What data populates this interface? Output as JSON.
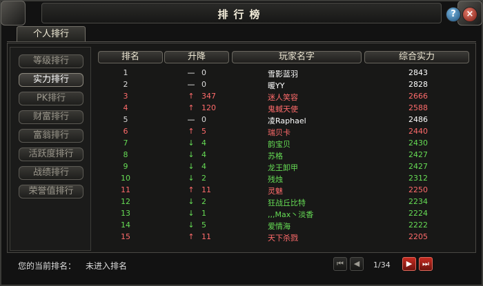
{
  "window": {
    "title": "排行榜",
    "help_label": "?",
    "close_label": "×"
  },
  "tabs": [
    {
      "label": "个人排行"
    }
  ],
  "sidebar": {
    "items": [
      {
        "label": "等级排行"
      },
      {
        "label": "实力排行",
        "active": true
      },
      {
        "label": "PK排行"
      },
      {
        "label": "财富排行"
      },
      {
        "label": "富翁排行"
      },
      {
        "label": "活跃度排行"
      },
      {
        "label": "战绩排行"
      },
      {
        "label": "荣誉值排行"
      }
    ]
  },
  "table": {
    "headers": [
      "排名",
      "升降",
      "玩家名字",
      "综合实力"
    ],
    "rows": [
      {
        "rank": "1",
        "trend": "same",
        "change": "0",
        "name": "雪影蓝羽",
        "power": "2843",
        "color": "#ffffff"
      },
      {
        "rank": "2",
        "trend": "same",
        "change": "0",
        "name": "暖YY",
        "power": "2828",
        "color": "#ffffff"
      },
      {
        "rank": "3",
        "trend": "up",
        "change": "347",
        "name": "迷人笑容",
        "power": "2666",
        "color": "#ff6b6b"
      },
      {
        "rank": "4",
        "trend": "up",
        "change": "120",
        "name": "鬼蜮天使",
        "power": "2588",
        "color": "#ff6b6b"
      },
      {
        "rank": "5",
        "trend": "same",
        "change": "0",
        "name": "凌Raphael",
        "power": "2486",
        "color": "#ffffff"
      },
      {
        "rank": "6",
        "trend": "up",
        "change": "5",
        "name": "瑞贝卡",
        "power": "2440",
        "color": "#ff6b6b"
      },
      {
        "rank": "7",
        "trend": "down",
        "change": "4",
        "name": "韵宝贝",
        "power": "2430",
        "color": "#66dd55"
      },
      {
        "rank": "8",
        "trend": "down",
        "change": "4",
        "name": "苏格",
        "power": "2427",
        "color": "#66dd55"
      },
      {
        "rank": "9",
        "trend": "down",
        "change": "4",
        "name": "龙王卸甲",
        "power": "2427",
        "color": "#66dd55"
      },
      {
        "rank": "10",
        "trend": "down",
        "change": "2",
        "name": "残烛",
        "power": "2312",
        "color": "#66dd55"
      },
      {
        "rank": "11",
        "trend": "up",
        "change": "11",
        "name": "灵魅",
        "power": "2250",
        "color": "#ff6b6b"
      },
      {
        "rank": "12",
        "trend": "down",
        "change": "2",
        "name": "狂战丘比特",
        "power": "2234",
        "color": "#66dd55"
      },
      {
        "rank": "13",
        "trend": "down",
        "change": "1",
        "name": ",,,Max丶淡香",
        "power": "2224",
        "color": "#66dd55"
      },
      {
        "rank": "14",
        "trend": "down",
        "change": "5",
        "name": "爱情海",
        "power": "2222",
        "color": "#66dd55"
      },
      {
        "rank": "15",
        "trend": "up",
        "change": "11",
        "name": "天下杀戮",
        "power": "2205",
        "color": "#ff6b6b"
      }
    ]
  },
  "trend_symbols": {
    "same": "—",
    "up": "↑",
    "down": "↓"
  },
  "trend_colors": {
    "same": "#ffffff",
    "up": "#ff6b6b",
    "down": "#66dd55"
  },
  "footer": {
    "label": "您的当前排名：",
    "value": "未进入排名"
  },
  "pagination": {
    "text": "1/34",
    "first": "⏮",
    "prev": "◀",
    "next": "▶",
    "last": "⏭"
  }
}
